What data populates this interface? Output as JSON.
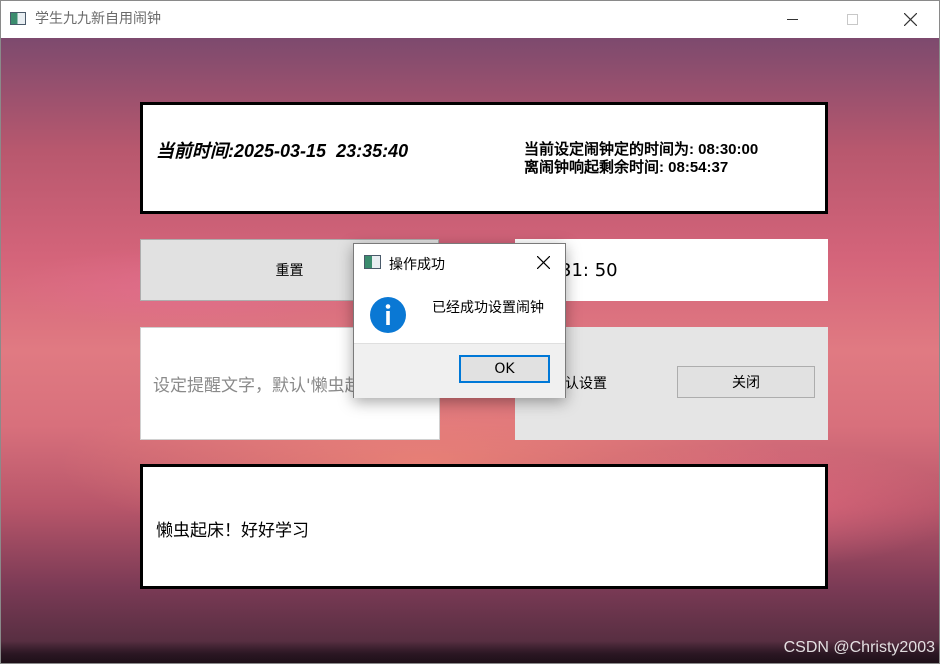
{
  "window": {
    "title": "学生九九新自用闹钟"
  },
  "clock": {
    "current_time": "当前时间:2025-03-15  23:35:40",
    "alarm_time_line": "当前设定闹钟定的时间为: 08:30:00",
    "remaining_line": "离闹钟响起剩余时间: 08:54:37"
  },
  "controls": {
    "reset_label": "重置",
    "time_value": "31:  50",
    "remind_placeholder": "设定提醒文字，默认'懒虫起床！好好学习'",
    "confirm_label": "确认设置",
    "close_label": "关闭"
  },
  "message": {
    "text": "懒虫起床！好好学习"
  },
  "dialog": {
    "title": "操作成功",
    "message": "已经成功设置闹钟",
    "ok_label": "OK",
    "icon": "info-icon"
  },
  "watermark": "CSDN @Christy2003",
  "colors": {
    "accent": "#0078d7",
    "info_icon": "#0a78d4"
  }
}
